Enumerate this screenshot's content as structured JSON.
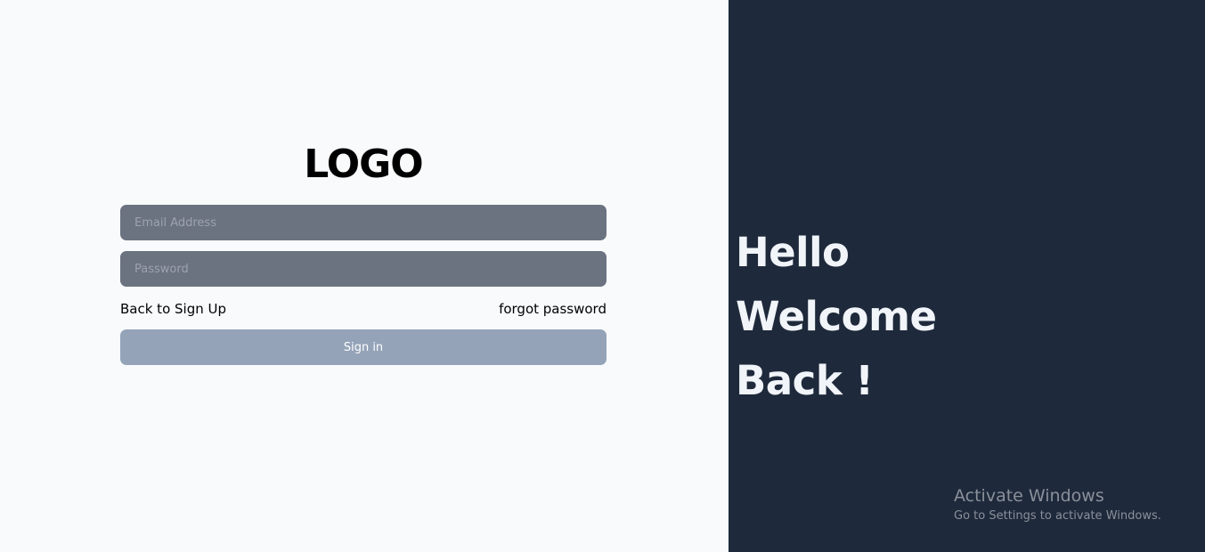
{
  "login": {
    "logo_text": "LOGO",
    "email_placeholder": "Email Address",
    "password_placeholder": "Password",
    "back_link": "Back to Sign Up",
    "forgot_link": "forgot password",
    "signin_label": "Sign in"
  },
  "welcome": {
    "lines": [
      "Hello",
      "Welcome",
      "Back !"
    ]
  },
  "watermark": {
    "title": "Activate Windows",
    "subtitle": "Go to Settings to activate Windows."
  },
  "colors": {
    "left_background": "#f8fafc",
    "right_background": "#1e293b",
    "input_background": "#6b7280",
    "button_background": "#94a3b8"
  }
}
